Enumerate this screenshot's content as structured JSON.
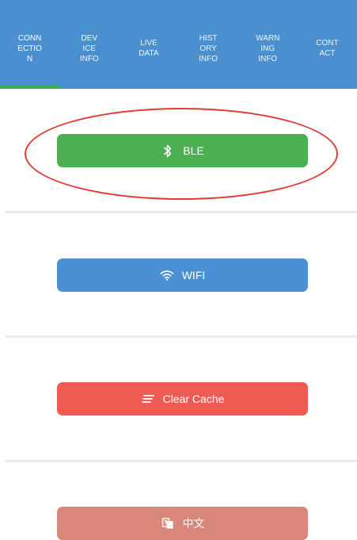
{
  "tabs": [
    {
      "label": "CONN\nECTIO\nN",
      "active": true
    },
    {
      "label": "DEV\nICE\nINFO",
      "active": false
    },
    {
      "label": "LIVE\nDATA",
      "active": false
    },
    {
      "label": "HIST\nORY\nINFO",
      "active": false
    },
    {
      "label": "WARN\nING\nINFO",
      "active": false
    },
    {
      "label": "CONT\nACT",
      "active": false
    }
  ],
  "buttons": {
    "ble": {
      "label": "BLE",
      "icon": "bluetooth-icon",
      "color": "#4caf50"
    },
    "wifi": {
      "label": "WIFI",
      "icon": "wifi-icon",
      "color": "#4a90d2"
    },
    "clear_cache": {
      "label": "Clear Cache",
      "icon": "clear-list-icon",
      "color": "#ef5b52"
    },
    "language": {
      "label": "中文",
      "icon": "translate-icon",
      "color": "#d9867b"
    }
  },
  "colors": {
    "tabbar": "#4a8fd0",
    "active_underline": "#3fb24f",
    "highlight_ellipse": "#e23a34"
  }
}
